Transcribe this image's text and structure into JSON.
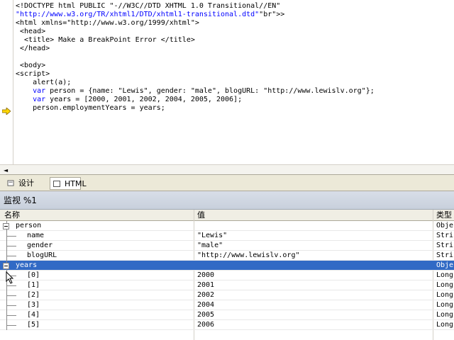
{
  "code_lines": [
    "<!DOCTYPE html PUBLIC \"-//W3C//DTD XHTML 1.0 Transitional//EN\"",
    "\"http://www.w3.org/TR/xhtml1/DTD/xhtml1-transitional.dtd\">",
    "<html xmlns=\"http://www.w3.org/1999/xhtml\">",
    " <head>",
    "  <title> Make a BreakPoint Error </title>",
    " </head>",
    "",
    " <body>",
    "<script>",
    "    alert(a);",
    "    var person = {name: \"Lewis\", gender: \"male\", blogURL: \"http://www.lewislv.org\"};",
    "    var years = [2000, 2001, 2002, 2004, 2005, 2006];",
    "    person.employmentYears = years;"
  ],
  "tabs": {
    "design": "设计",
    "html": "HTML"
  },
  "scroll_left": "◄",
  "watch": {
    "title": "监视 %1",
    "col_name": "名称",
    "col_value": "值",
    "col_type": "类型",
    "rows": [
      {
        "name": "person",
        "value": "",
        "type": "Obje",
        "indent": 0,
        "expander": true
      },
      {
        "name": "name",
        "value": "\"Lewis\"",
        "type": "Stri",
        "indent": 1
      },
      {
        "name": "gender",
        "value": "\"male\"",
        "type": "Stri",
        "indent": 1
      },
      {
        "name": "blogURL",
        "value": "\"http://www.lewislv.org\"",
        "type": "Stri",
        "indent": 1
      },
      {
        "name": "years",
        "value": "",
        "type": "Obje",
        "indent": 0,
        "expander": true,
        "selected": true
      },
      {
        "name": "[0]",
        "value": "2000",
        "type": "Long",
        "indent": 1
      },
      {
        "name": "[1]",
        "value": "2001",
        "type": "Long",
        "indent": 1
      },
      {
        "name": "[2]",
        "value": "2002",
        "type": "Long",
        "indent": 1
      },
      {
        "name": "[3]",
        "value": "2004",
        "type": "Long",
        "indent": 1
      },
      {
        "name": "[4]",
        "value": "2005",
        "type": "Long",
        "indent": 1
      },
      {
        "name": "[5]",
        "value": "2006",
        "type": "Long",
        "indent": 1
      }
    ]
  }
}
